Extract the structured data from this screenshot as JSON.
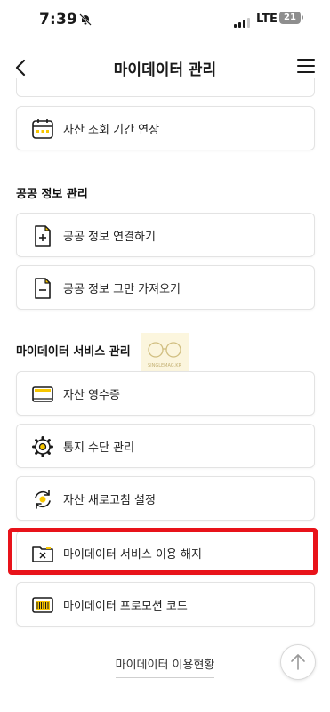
{
  "status_bar": {
    "time": "7:39",
    "network": "LTE",
    "battery": "21"
  },
  "header": {
    "title": "마이데이터 관리"
  },
  "asset_section": {
    "items": [
      {
        "label": "자산 조회 기간 연장",
        "icon": "calendar-icon"
      }
    ]
  },
  "public_section": {
    "title": "공공 정보 관리",
    "items": [
      {
        "label": "공공 정보 연결하기",
        "icon": "document-plus-icon"
      },
      {
        "label": "공공 정보 그만 가져오기",
        "icon": "document-minus-icon"
      }
    ]
  },
  "mydata_section": {
    "title": "마이데이터 서비스 관리",
    "items": [
      {
        "label": "자산 영수증",
        "icon": "receipt-icon"
      },
      {
        "label": "통지 수단 관리",
        "icon": "gear-icon"
      },
      {
        "label": "자산 새로고침 설정",
        "icon": "refresh-icon"
      },
      {
        "label": "마이데이터 서비스 이용 해지",
        "icon": "folder-x-icon"
      },
      {
        "label": "마이데이터 프로모션 코드",
        "icon": "barcode-icon"
      }
    ]
  },
  "watermark": {
    "text": "SINGLEMAG.KR"
  },
  "footer": {
    "link": "마이데이터 이용현황"
  },
  "colors": {
    "accent": "#f7c600",
    "highlight": "#e8131a"
  }
}
